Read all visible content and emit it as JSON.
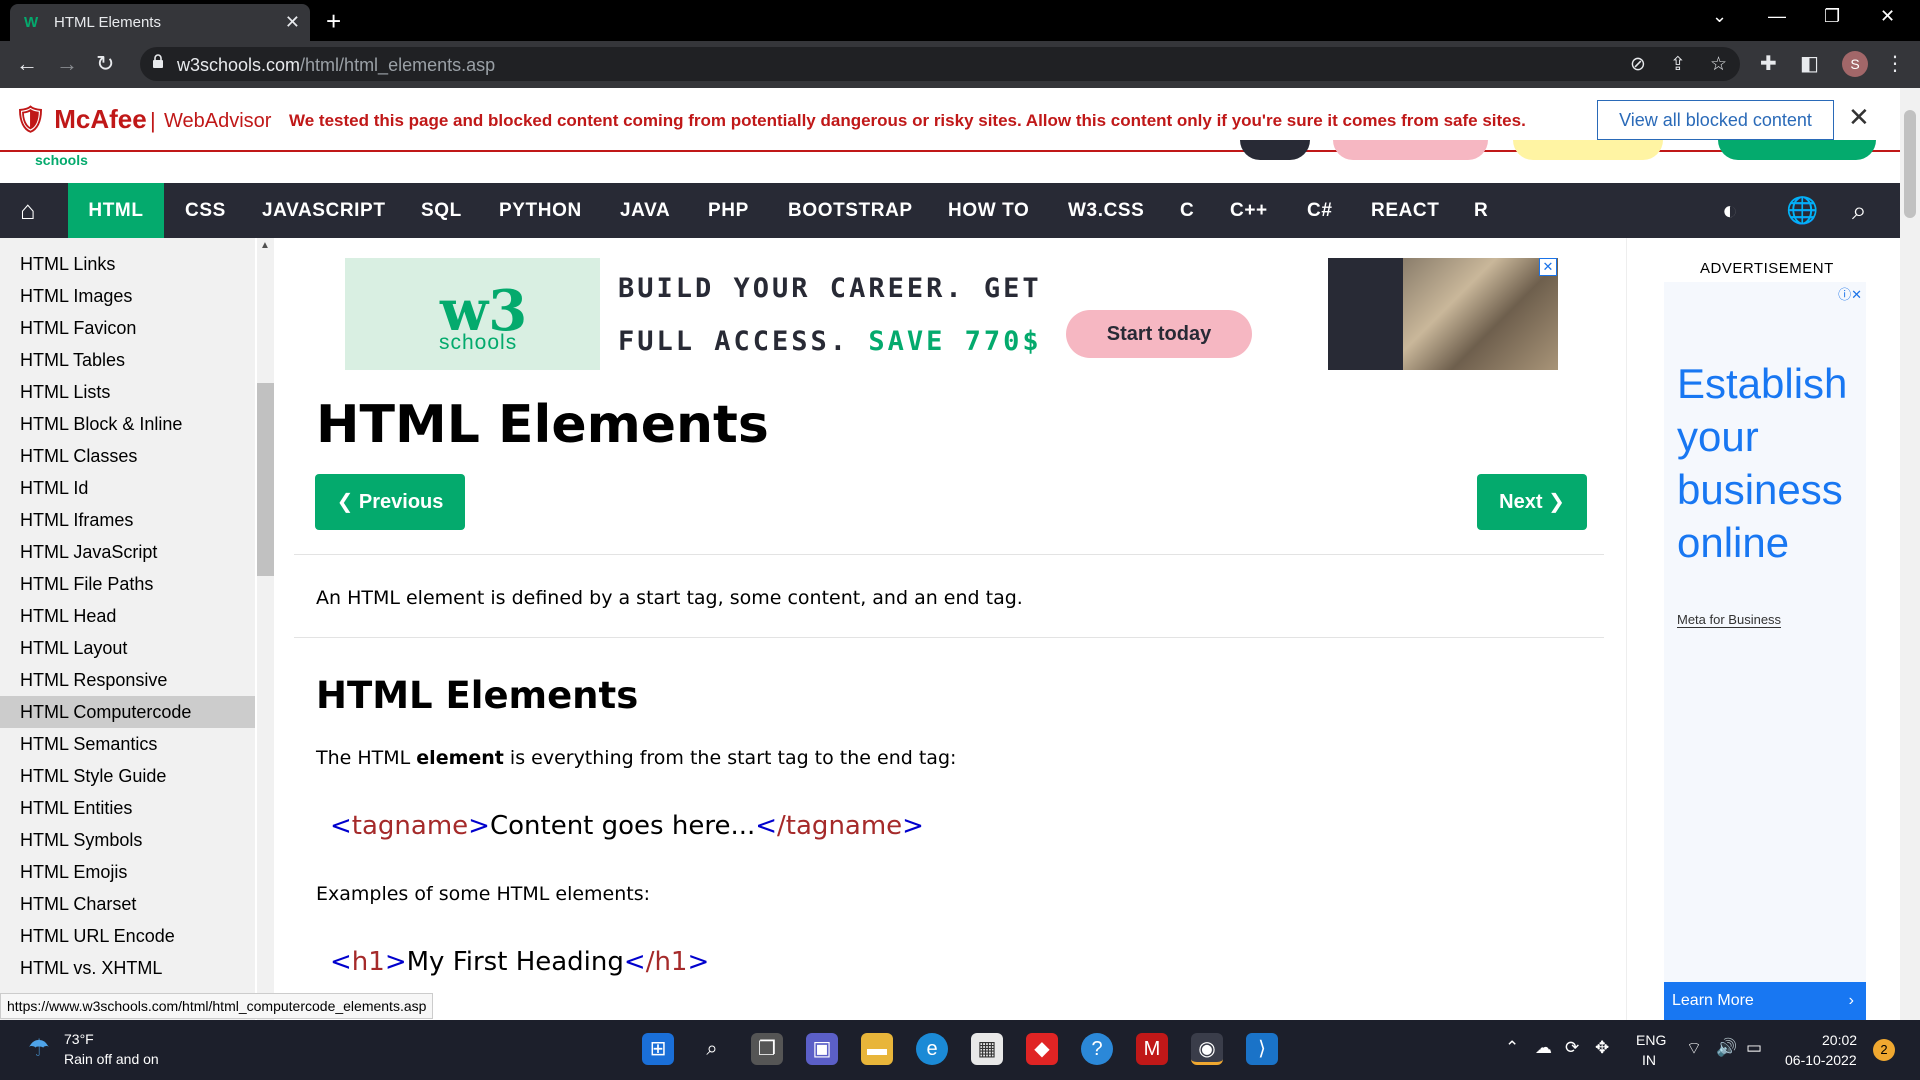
{
  "browser": {
    "tab_title": "HTML Elements",
    "tab_close": "✕",
    "new_tab": "+",
    "url_domain": "w3schools.com",
    "url_path": "/html/html_elements.asp",
    "profile_initial": "S"
  },
  "mcafee": {
    "logo": "McAfee",
    "separator": "|",
    "product": "WebAdvisor",
    "message": "We tested this page and blocked content coming from potentially dangerous or risky sites. Allow this content only if you're sure it comes from safe sites.",
    "button": "View all blocked content",
    "close": "✕"
  },
  "w3header": {
    "logo_text": "schools"
  },
  "topnav": {
    "items": [
      "HTML",
      "CSS",
      "JAVASCRIPT",
      "SQL",
      "PYTHON",
      "JAVA",
      "PHP",
      "BOOTSTRAP",
      "HOW TO",
      "W3.CSS",
      "C",
      "C++",
      "C#",
      "REACT",
      "R"
    ],
    "active": "HTML"
  },
  "sidebar": {
    "links": [
      "HTML Links",
      "HTML Images",
      "HTML Favicon",
      "HTML Tables",
      "HTML Lists",
      "HTML Block & Inline",
      "HTML Classes",
      "HTML Id",
      "HTML Iframes",
      "HTML JavaScript",
      "HTML File Paths",
      "HTML Head",
      "HTML Layout",
      "HTML Responsive",
      "HTML Computercode",
      "HTML Semantics",
      "HTML Style Guide",
      "HTML Entities",
      "HTML Symbols",
      "HTML Emojis",
      "HTML Charset",
      "HTML URL Encode",
      "HTML vs. XHTML"
    ],
    "selected": "HTML Computercode"
  },
  "ad_banner": {
    "brand_top": "w3",
    "brand_bottom": "schools",
    "line1": "BUILD YOUR CAREER. GET",
    "line2_prefix": "FULL ACCESS.",
    "line2_highlight": "SAVE 770$",
    "button": "Start today",
    "close": "✕"
  },
  "main": {
    "title": "HTML Elements",
    "prev_button": "❮ Previous",
    "next_button": "Next ❯",
    "intro": "An HTML element is defined by a start tag, some content, and an end tag.",
    "section_title": "HTML Elements",
    "desc_prefix": "The HTML ",
    "desc_bold": "element",
    "desc_suffix": " is everything from the start tag to the end tag:",
    "code1": {
      "open_tag": "tagname",
      "content": "Content goes here...",
      "close_tag": "/tagname"
    },
    "examples_label": "Examples of some HTML elements:",
    "code2": {
      "open_tag": "h1",
      "content": "My First Heading",
      "close_tag": "/h1"
    }
  },
  "right_ad": {
    "label": "ADVERTISEMENT",
    "headline": "Establish your business online",
    "brand": "Meta for Business",
    "cta": "Learn More",
    "cta_chevron": "›"
  },
  "status_bar": {
    "url": "https://www.w3schools.com/html/html_computercode_elements.asp"
  },
  "taskbar": {
    "temperature": "73°F",
    "weather": "Rain off and on",
    "lang_line1": "ENG",
    "lang_line2": "IN",
    "time": "20:02",
    "date": "06-10-2022",
    "notifications": "2"
  },
  "colors": {
    "w3_green": "#04aa6d",
    "nav_dark": "#282a35",
    "mcafee_red": "#c01818",
    "meta_blue": "#1877f2"
  }
}
